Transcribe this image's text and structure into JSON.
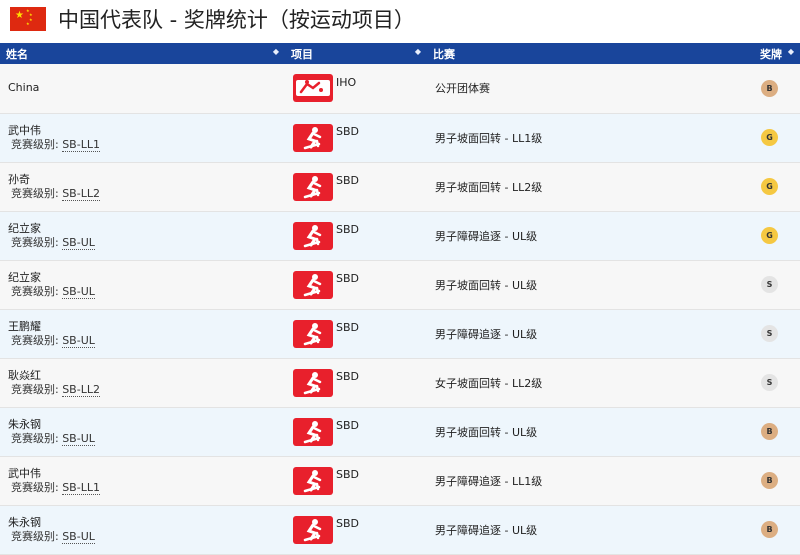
{
  "page": {
    "title": "中国代表队 - 奖牌统计（按运动项目）",
    "flag_icon": "china-flag-icon"
  },
  "table": {
    "headers": {
      "name": "姓名",
      "sport": "项目",
      "event": "比赛",
      "medal": "奖牌"
    },
    "class_label": "竞赛级别: ",
    "medal_colors": {
      "G": "#f5c842",
      "S": "#e4e4e4",
      "B": "#dcae82"
    },
    "rows": [
      {
        "name": "China",
        "class": "",
        "sport": "IHO",
        "event": "公开团体赛",
        "medal": "B"
      },
      {
        "name": "武中伟",
        "class": "SB-LL1",
        "sport": "SBD",
        "event": "男子坡面回转 - LL1级",
        "medal": "G"
      },
      {
        "name": "孙奇",
        "class": "SB-LL2",
        "sport": "SBD",
        "event": "男子坡面回转 - LL2级",
        "medal": "G"
      },
      {
        "name": "纪立家",
        "class": "SB-UL",
        "sport": "SBD",
        "event": "男子障碍追逐 - UL级",
        "medal": "G"
      },
      {
        "name": "纪立家",
        "class": "SB-UL",
        "sport": "SBD",
        "event": "男子坡面回转 - UL级",
        "medal": "S"
      },
      {
        "name": "王鹏耀",
        "class": "SB-UL",
        "sport": "SBD",
        "event": "男子障碍追逐 - UL级",
        "medal": "S"
      },
      {
        "name": "耿焱红",
        "class": "SB-LL2",
        "sport": "SBD",
        "event": "女子坡面回转 - LL2级",
        "medal": "S"
      },
      {
        "name": "朱永钢",
        "class": "SB-UL",
        "sport": "SBD",
        "event": "男子坡面回转 - UL级",
        "medal": "B"
      },
      {
        "name": "武中伟",
        "class": "SB-LL1",
        "sport": "SBD",
        "event": "男子障碍追逐 - LL1级",
        "medal": "B"
      },
      {
        "name": "朱永钢",
        "class": "SB-UL",
        "sport": "SBD",
        "event": "男子障碍追逐 - UL级",
        "medal": "B"
      }
    ]
  }
}
